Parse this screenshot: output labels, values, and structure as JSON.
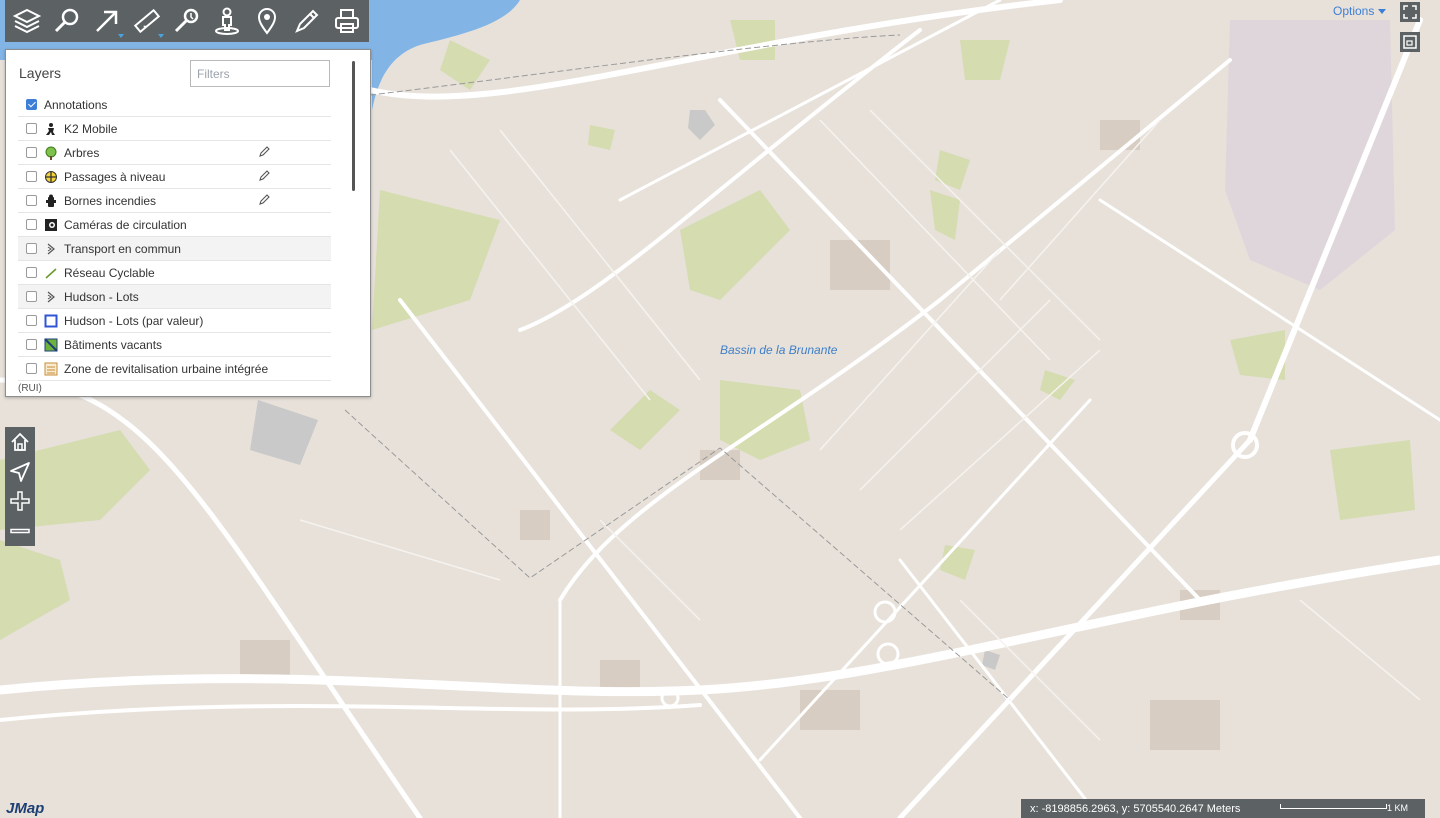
{
  "toolbar": {
    "tools": [
      {
        "icon": "layers-icon"
      },
      {
        "icon": "search-icon"
      },
      {
        "icon": "select-arrow-icon",
        "has_menu": true
      },
      {
        "icon": "measure-ruler-icon",
        "has_menu": true
      },
      {
        "icon": "search-location-icon"
      },
      {
        "icon": "street-view-icon"
      },
      {
        "icon": "map-pin-icon"
      },
      {
        "icon": "draw-pencil-icon"
      },
      {
        "icon": "print-icon"
      }
    ]
  },
  "layers_panel": {
    "title": "Layers",
    "filter_placeholder": "Filters",
    "items": [
      {
        "label": "Annotations",
        "checked": true,
        "icon": "none",
        "group": false,
        "editable": false
      },
      {
        "label": "K2 Mobile",
        "checked": false,
        "icon": "mobile-person-icon",
        "group": false,
        "editable": false
      },
      {
        "label": "Arbres",
        "checked": false,
        "icon": "tree-icon",
        "group": false,
        "editable": true
      },
      {
        "label": "Passages à niveau",
        "checked": false,
        "icon": "railway-crossing-icon",
        "group": false,
        "editable": true
      },
      {
        "label": "Bornes incendies",
        "checked": false,
        "icon": "fire-hydrant-icon",
        "group": false,
        "editable": true
      },
      {
        "label": "Caméras de circulation",
        "checked": false,
        "icon": "traffic-camera-icon",
        "group": false,
        "editable": false
      },
      {
        "label": "Transport en commun",
        "checked": false,
        "icon": "group-chevron-icon",
        "group": true,
        "editable": false
      },
      {
        "label": "Réseau Cyclable",
        "checked": false,
        "icon": "bike-line-icon",
        "group": false,
        "editable": false
      },
      {
        "label": "Hudson - Lots",
        "checked": false,
        "icon": "group-chevron-icon",
        "group": true,
        "editable": false
      },
      {
        "label": "Hudson - Lots (par valeur)",
        "checked": false,
        "icon": "blue-square-icon",
        "group": false,
        "editable": false
      },
      {
        "label": "Bâtiments vacants",
        "checked": false,
        "icon": "hatched-square-icon",
        "group": false,
        "editable": false
      },
      {
        "label": "Zone de revitalisation urbaine intégrée",
        "checked": false,
        "icon": "orange-hatch-icon",
        "group": false,
        "editable": false
      }
    ],
    "wrapped_text": "(RUI)"
  },
  "nav": {
    "buttons": [
      {
        "icon": "home-icon"
      },
      {
        "icon": "locate-arrow-icon"
      },
      {
        "icon": "zoom-in-icon"
      },
      {
        "icon": "zoom-out-icon"
      }
    ]
  },
  "options": {
    "label": "Options"
  },
  "map": {
    "place_label": "Bassin de la Brunante",
    "colors": {
      "land": "#e7e1da",
      "road": "#ffffff",
      "park": "#d5dcb0",
      "water": "#82b5e6",
      "building": "#d6ccc2"
    }
  },
  "status": {
    "coordinates": "x: -8198856.2963, y: 5705540.2647 Meters",
    "scale_label": "1 KM"
  },
  "logo": "JMap"
}
